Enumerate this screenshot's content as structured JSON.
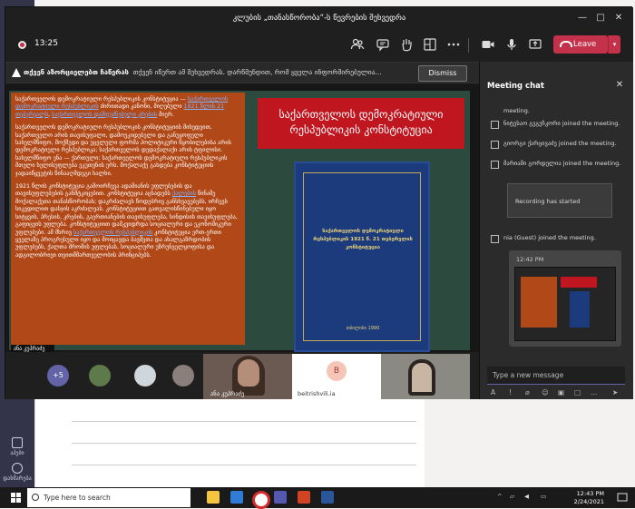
{
  "window": {
    "title": "კლუბის „თანასწორობა“-ს წევრების შეხვედრა",
    "controls": [
      "—",
      "□",
      "✕"
    ]
  },
  "meeting": {
    "timer": "13:25",
    "leave_label": "Leave",
    "accent": "#c4314b"
  },
  "banner": {
    "bold": "თქვენ აზორციელებთ ჩაწერას",
    "text": "თქვენ იწერთ ამ შეხვედრას. დარწმუნდით, რომ ყველა ინფორმირებულია...",
    "dismiss_label": "Dismiss"
  },
  "slide": {
    "p1_a": "საქართველოს დემოკრატიული რესპუბლიკის კონსტიტუცია —",
    "p1_link": "საქართველოს დემოკრატიული რესპუბლიკის",
    "p1_b": "ძირითადი კანონი, მიღებული",
    "p1_link2": "1921 წლის 21 თებერვალს",
    "p1_c": ",",
    "p1_link3": "საქართველოს დამფუძნებელი კრების",
    "p1_d": "მიერ.",
    "p2": "საქართველოს დემოკრატიული რესპუბლიკის კონსტიტუციის მიხედვით, საქართველო არის თავისუფალი, დამოუკიდებელი და განუყოფელი სახელმწიფო, მოქმედი და უცვლელი ფორმა პოლიტიკური წყობილებისა არის დემოკრატიული რესპუბლიკა; საქართველოს დედაქალაქი არის ტფილისი. სახელმწიფო ენა — ქართული; საქართველოს დემოკრატიული რესპუბლიკის მთელი ხელისუფლება ეკუთვნის ერს. მოქალაქე გახდება კონსტიტუციის ჯადაიწყვეტის წინააღმდეგი ხალხი.",
    "p3_a": "1921 წლის კონსტიტუცია გამოირჩევა ადამიანის უფლებების და თავისუფლებების განმტკიცებით. კონსტიტუცია აცხადებს",
    "p3_link": "ქალების",
    "p3_b": "წინაშე მოქალაქეთა თანასწორობას; დაკრძალავს წოდებრივ განსხვავებებს, ირჩევს სიკვდილით დასჯის აკრძალვას. კონსტიტუციით გათვალისწინებული იყო სიტყვის, პრესის, კრების, გაერთიანების თავისუფლება, სინდისის თავისუფლება, გაფიცვის უფლება. კონსტიტუციით დამკვიდრდა სოციალური და ეკონომიკური უფლებები. ამ მხრივ",
    "p3_link2": "საქართველოს რესპუბლიკის",
    "p3_c": "კონსტიტუცია ერთ-ერთი ყველაზე პროგრესული იყო და მოიცავდა ბავშვთა და ახალგაზრდობის უფლებებს, ქალთა შრომის უფლებას, სოციალური უზრუნველყოფისა და ადგილობრივი თვითმმართველობის პრინციპებს.",
    "presenter_tag": "ანა კუპრაძე",
    "title": "საქართველოს დემოკრატიული რესპუბლიკის კონსტიტუცია",
    "book_text": "საქართველოს დემოკრატიული რესპუბლიკის 1921 წ. 21 თებერვლის კონსტიტუცია",
    "book_bottom": "თბილისი 1990"
  },
  "participants": {
    "more_label": "+5",
    "tile1_name": "ანა კუპრაძე",
    "tile2_avatar": "B",
    "tile2_name": "beitrishvili.ia"
  },
  "chat": {
    "title": "Meeting chat",
    "messages": [
      "meeting.",
      "ნიტუსაო გეგეჩკორი joined the meeting.",
      "გიორგი ქარცივაძე joined the meeting.",
      "მარიამი გორდელია joined the meeting."
    ],
    "recording_card": "Recording has started",
    "guest_msg": "nia (Guest) joined the meeting.",
    "image_time": "12:42 PM",
    "input_placeholder": "Type a new message"
  },
  "taskbar": {
    "search_placeholder": "Type here to search",
    "time": "12:43 PM",
    "date": "2/24/2021"
  },
  "background": {
    "rail_apps_label": "აპები",
    "rail_help_label": "დახმარება"
  }
}
